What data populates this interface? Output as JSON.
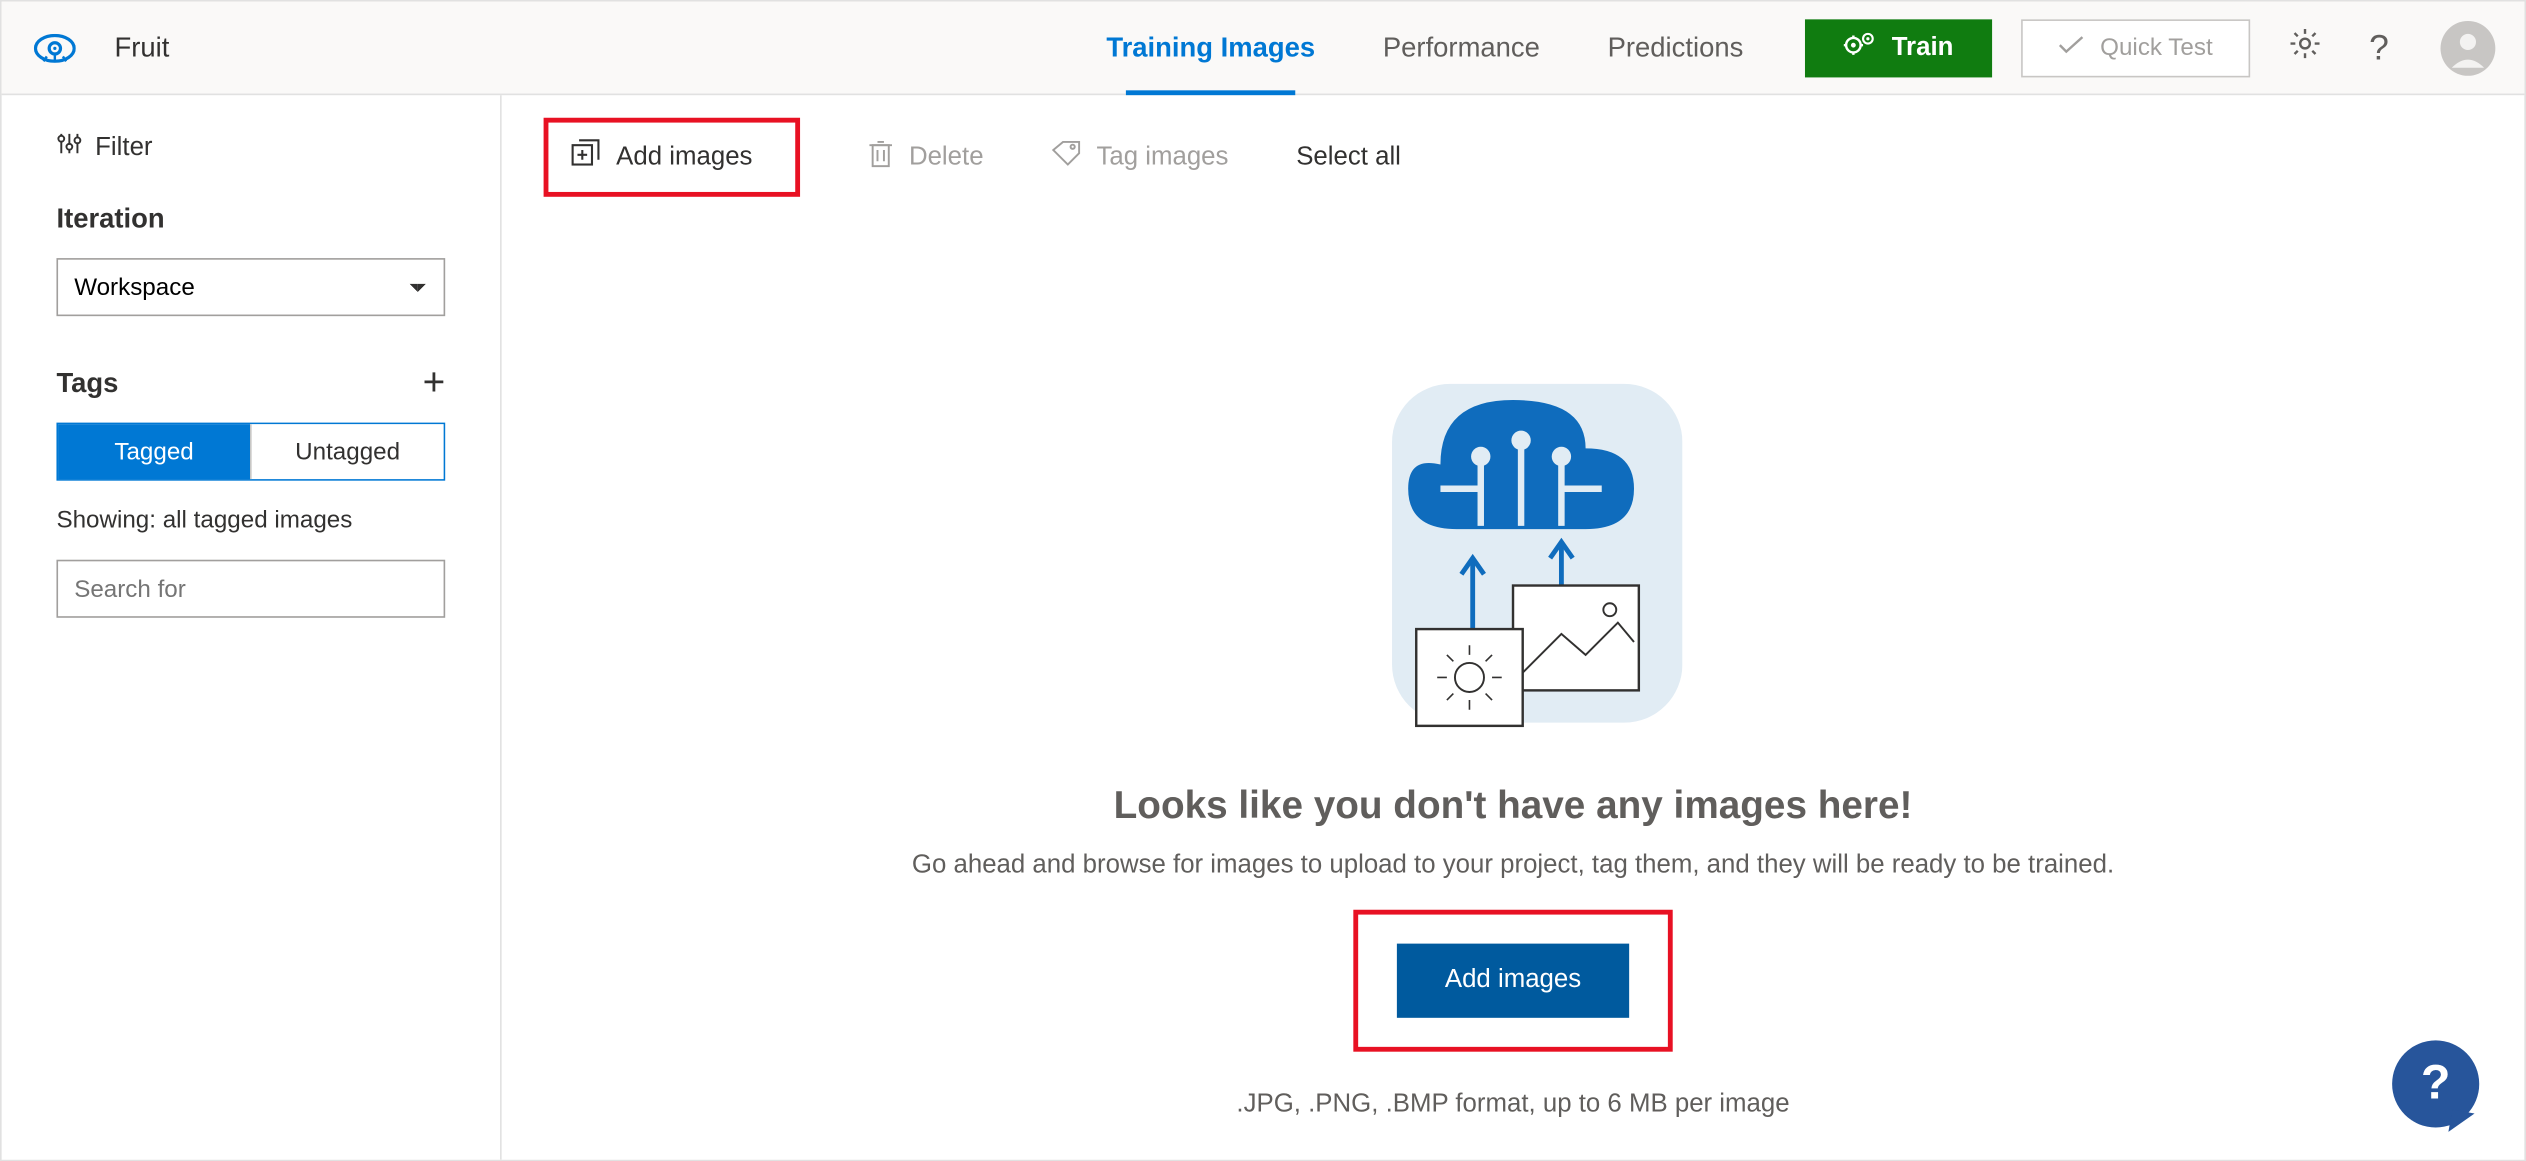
{
  "header": {
    "project_name": "Fruit",
    "tabs": [
      {
        "label": "Training Images",
        "active": true
      },
      {
        "label": "Performance",
        "active": false
      },
      {
        "label": "Predictions",
        "active": false
      }
    ],
    "train_label": "Train",
    "quick_test_label": "Quick Test"
  },
  "sidebar": {
    "filter_label": "Filter",
    "iteration_label": "Iteration",
    "iteration_value": "Workspace",
    "tags_label": "Tags",
    "tagged_label": "Tagged",
    "untagged_label": "Untagged",
    "showing_text": "Showing: all tagged images",
    "search_placeholder": "Search for"
  },
  "toolbar": {
    "add_images": "Add images",
    "delete": "Delete",
    "tag_images": "Tag images",
    "select_all": "Select all"
  },
  "empty": {
    "title": "Looks like you don't have any images here!",
    "subtitle": "Go ahead and browse for images to upload to your project, tag them, and they will be ready to be trained.",
    "add_label": "Add images",
    "format_hint": ".JPG, .PNG, .BMP format, up to 6 MB per image"
  }
}
